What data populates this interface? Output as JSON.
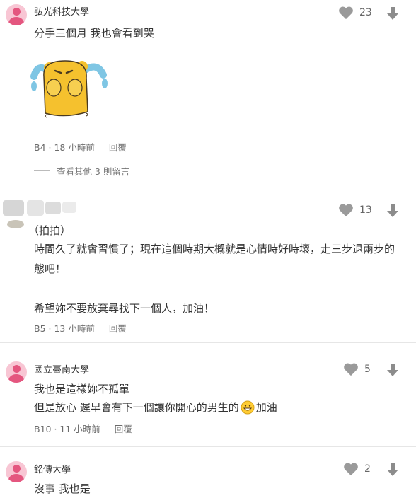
{
  "comments": [
    {
      "school": "弘光科技大學",
      "text": [
        "分手三個月 我也會看到哭"
      ],
      "floor": "B4",
      "time": "18 小時前",
      "reply": "回覆",
      "likes": "23",
      "sticker": "crying-bear-sticker",
      "more_replies": "查看其他 3 則留言"
    },
    {
      "school": "",
      "text": [
        "（拍拍）",
        "時間久了就會習慣了；現在這個時期大概就是心情時好時壞，走三步退兩步的",
        "態吧！",
        "",
        "希望妳不要放棄尋找下一個人，加油！"
      ],
      "floor": "B5",
      "time": "13 小時前",
      "reply": "回覆",
      "likes": "13"
    },
    {
      "school": "國立臺南大學",
      "text": [
        "我也是這樣妳不孤單",
        "但是放心 遲早會有下一個讓你開心的男生的",
        "加油"
      ],
      "floor": "B10",
      "time": "11 小時前",
      "reply": "回覆",
      "likes": "5",
      "emoji": "grinning-face-emoji"
    },
    {
      "school": "銘傳大學",
      "text": [
        "沒事 我也是"
      ],
      "likes": "2"
    }
  ],
  "colors": {
    "avatar_bg": "#f8c6d4",
    "avatar_fg": "#e4567f",
    "icon": "#9a9a9a",
    "divider": "#e6e6e6"
  },
  "icons": {
    "like": "heart-icon",
    "dislike": "arrow-down-icon"
  }
}
